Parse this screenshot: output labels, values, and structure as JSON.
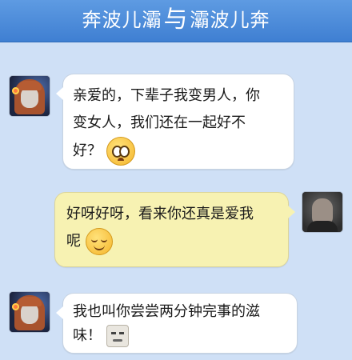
{
  "header": {
    "title_left": "奔波儿灞",
    "separator": "与",
    "title_right": "灞波儿奔"
  },
  "messages": [
    {
      "sender": "girl-avatar",
      "lines": [
        "亲爱的，下辈子我变男人，你",
        "变女人，我们还在一起好不",
        "好？"
      ],
      "emoji": "worried-face-emoji"
    },
    {
      "sender": "guy-avatar",
      "lines": [
        "好呀好呀，看来你还真是爱我",
        "呢"
      ],
      "emoji": "smile-face-emoji"
    },
    {
      "sender": "girl-avatar",
      "lines": [
        "我也叫你尝尝两分钟完事的滋",
        "味！"
      ],
      "emoji": "meme-face-emoji"
    }
  ],
  "colors": {
    "background": "#cfe0f6",
    "header": "#4a8ad8",
    "incoming_bubble": "#ffffff",
    "outgoing_bubble": "#f7f2b2"
  }
}
